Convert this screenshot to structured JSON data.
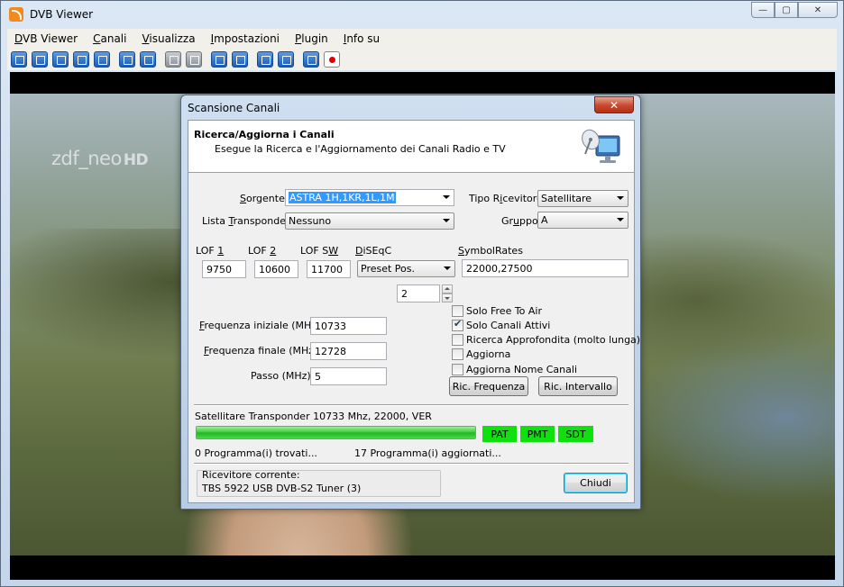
{
  "window": {
    "title": "DVB Viewer"
  },
  "menu": {
    "items": [
      {
        "u": "D",
        "rest": "VB Viewer"
      },
      {
        "u": "C",
        "rest": "anali"
      },
      {
        "u": "V",
        "rest": "isualizza"
      },
      {
        "u": "I",
        "rest": "mpostazioni"
      },
      {
        "u": "P",
        "rest": "lugin"
      },
      {
        "u": "I",
        "rest": "nfo su"
      }
    ]
  },
  "video": {
    "logo_main": "zdf_neo",
    "logo_hd": "HD"
  },
  "dialog": {
    "title": "Scansione Canali",
    "close_glyph": "✕",
    "header": {
      "title": "Ricerca/Aggiorna i Canali",
      "subtitle": "Esegue la Ricerca e l'Aggiornamento dei Canali Radio e TV"
    },
    "sorgente": {
      "label_u": "S",
      "label_rest": "orgente",
      "value": "ASTRA 1H,1KR,1L,1M"
    },
    "lista_transponder": {
      "label_pre": "Lista ",
      "label_u": "T",
      "label_rest": "ransponder",
      "value": "Nessuno"
    },
    "tipo_ricevitore": {
      "label_pre": "Tipo R",
      "label_u": "i",
      "label_rest": "cevitore",
      "value": "Satellitare"
    },
    "gruppo": {
      "label_pre": "Gr",
      "label_u": "u",
      "label_rest": "ppo",
      "value": "A"
    },
    "lof1": {
      "label_pre": "LOF ",
      "label_u": "1",
      "value": "9750"
    },
    "lof2": {
      "label_pre": "LOF ",
      "label_u": "2",
      "value": "10600"
    },
    "lofsw": {
      "label_pre": "LOF S",
      "label_u": "W",
      "value": "11700"
    },
    "diseqc": {
      "label_u": "D",
      "label_rest": "iSEqC",
      "value": "Preset Pos.",
      "position": "2"
    },
    "symbolrates": {
      "label_u": "S",
      "label_rest": "ymbolRates",
      "value": "22000,27500"
    },
    "freq_iniziale": {
      "label_u": "F",
      "label_rest": "requenza iniziale (MHz)",
      "value": "10733"
    },
    "freq_finale": {
      "label_u": "F",
      "label_rest": "requenza finale (MHz)",
      "value": "12728"
    },
    "passo": {
      "label": "Passo (MHz)",
      "value": "5"
    },
    "checkboxes": [
      {
        "label": "Solo Free To Air",
        "checked": false
      },
      {
        "label": "Solo Canali Attivi",
        "checked": true
      },
      {
        "label": "Ricerca Approfondita (molto lunga)",
        "checked": false
      },
      {
        "label": "Aggiorna",
        "checked": false
      },
      {
        "label": "Aggiorna Nome Canali",
        "checked": false
      }
    ],
    "btn_frequenza": "Ric. Frequenza",
    "btn_intervallo": "Ric. Intervallo",
    "status_line": "Satellitare Transponder 10733 Mhz, 22000, VER",
    "progress": 1.0,
    "tags": [
      "PAT",
      "PMT",
      "SDT"
    ],
    "found": "0 Programma(i) trovati...",
    "updated": "17 Programma(i) aggiornati...",
    "receiver_label": "Ricevitore corrente:",
    "receiver_value": "TBS 5922 USB DVB-S2 Tuner (3)",
    "btn_close": "Chiudi"
  }
}
